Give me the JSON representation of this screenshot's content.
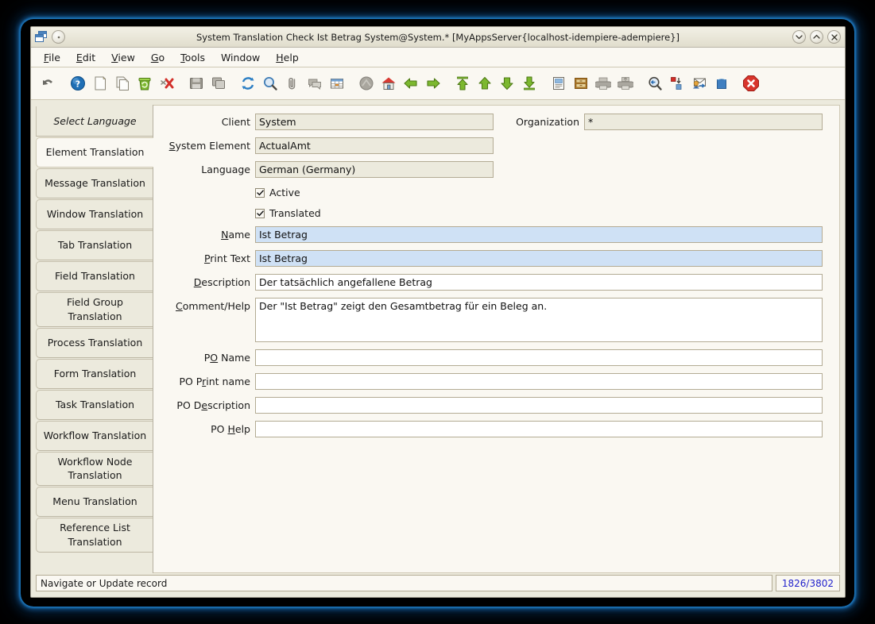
{
  "window": {
    "title": "System Translation Check  Ist Betrag  System@System.*  [MyAppsServer{localhost-idempiere-adempiere}]",
    "icon": "window-stack-icon",
    "minimize_label": "Minimize",
    "maximize_label": "Maximize",
    "close_label": "Close"
  },
  "menubar": {
    "items": [
      {
        "label": "File",
        "mnemonic": "F"
      },
      {
        "label": "Edit",
        "mnemonic": "E"
      },
      {
        "label": "View",
        "mnemonic": "V"
      },
      {
        "label": "Go",
        "mnemonic": "G"
      },
      {
        "label": "Tools",
        "mnemonic": "T"
      },
      {
        "label": "Window",
        "mnemonic": ""
      },
      {
        "label": "Help",
        "mnemonic": "H"
      }
    ]
  },
  "toolbar": {
    "buttons": [
      {
        "name": "undo-icon",
        "tip": "Undo"
      },
      {
        "name": "help-icon",
        "tip": "Help"
      },
      {
        "name": "new-record-icon",
        "tip": "New Record"
      },
      {
        "name": "copy-record-icon",
        "tip": "Copy Record"
      },
      {
        "name": "delete-record-icon",
        "tip": "Delete Record"
      },
      {
        "name": "delete-selection-icon",
        "tip": "Delete Selection"
      },
      {
        "name": "save-icon",
        "tip": "Save Changes"
      },
      {
        "name": "save-create-icon",
        "tip": "Save and Create New"
      },
      {
        "name": "refresh-icon",
        "tip": "Refresh"
      },
      {
        "name": "find-icon",
        "tip": "Find Records"
      },
      {
        "name": "attachment-icon",
        "tip": "Attachment"
      },
      {
        "name": "chat-icon",
        "tip": "Chat"
      },
      {
        "name": "grid-toggle-icon",
        "tip": "Toggle Grid View"
      },
      {
        "name": "history-icon",
        "tip": "History Records"
      },
      {
        "name": "home-icon",
        "tip": "Home"
      },
      {
        "name": "previous-record-icon",
        "tip": "Previous Record"
      },
      {
        "name": "next-record-icon",
        "tip": "Next Record"
      },
      {
        "name": "first-record-icon",
        "tip": "First Record"
      },
      {
        "name": "parent-record-icon",
        "tip": "Parent Record"
      },
      {
        "name": "detail-record-icon",
        "tip": "Detail Record"
      },
      {
        "name": "last-record-icon",
        "tip": "Last Record"
      },
      {
        "name": "report-icon",
        "tip": "Report"
      },
      {
        "name": "archive-icon",
        "tip": "Archived Documents"
      },
      {
        "name": "print-preview-icon",
        "tip": "Print Preview"
      },
      {
        "name": "print-icon",
        "tip": "Print"
      },
      {
        "name": "zoom-across-icon",
        "tip": "Zoom Across"
      },
      {
        "name": "active-workflow-icon",
        "tip": "Active Workflows"
      },
      {
        "name": "requests-icon",
        "tip": "Requests"
      },
      {
        "name": "product-info-icon",
        "tip": "Product Info"
      },
      {
        "name": "exit-icon",
        "tip": "Exit Window"
      }
    ]
  },
  "sidebar": {
    "tabs": [
      {
        "label": "Select Language",
        "style": "italic",
        "selected": false
      },
      {
        "label": "Element Translation",
        "style": "normal",
        "selected": true
      },
      {
        "label": "Message Translation",
        "style": "normal",
        "selected": false
      },
      {
        "label": "Window Translation",
        "style": "normal",
        "selected": false
      },
      {
        "label": "Tab Translation",
        "style": "normal",
        "selected": false
      },
      {
        "label": "Field Translation",
        "style": "normal",
        "selected": false
      },
      {
        "label": "Field Group Translation",
        "style": "normal",
        "selected": false
      },
      {
        "label": "Process Translation",
        "style": "normal",
        "selected": false
      },
      {
        "label": "Form Translation",
        "style": "normal",
        "selected": false
      },
      {
        "label": "Task Translation",
        "style": "normal",
        "selected": false
      },
      {
        "label": "Workflow Translation",
        "style": "normal",
        "selected": false
      },
      {
        "label": "Workflow Node Translation",
        "style": "normal",
        "selected": false
      },
      {
        "label": "Menu Translation",
        "style": "normal",
        "selected": false
      },
      {
        "label": "Reference List Translation",
        "style": "normal",
        "selected": false
      }
    ]
  },
  "form": {
    "client": {
      "label": "Client",
      "mnemonic": "",
      "value": "System"
    },
    "organization": {
      "label": "Organization",
      "mnemonic": "",
      "value": "*"
    },
    "system_element": {
      "label": "System Element",
      "mnemonic": "S",
      "value": "ActualAmt"
    },
    "language": {
      "label": "Language",
      "mnemonic": "",
      "value": "German (Germany)"
    },
    "active": {
      "label": "Active",
      "checked": true
    },
    "translated": {
      "label": "Translated",
      "checked": true
    },
    "name": {
      "label": "Name",
      "mnemonic": "N",
      "value": "Ist Betrag"
    },
    "print_text": {
      "label": "Print Text",
      "mnemonic": "P",
      "value": "Ist Betrag"
    },
    "description": {
      "label": "Description",
      "mnemonic": "D",
      "value": "Der tatsächlich angefallene Betrag"
    },
    "comment_help": {
      "label": "Comment/Help",
      "mnemonic": "C",
      "value": "Der \"Ist Betrag\" zeigt den Gesamtbetrag für ein Beleg an."
    },
    "po_name": {
      "label": "PO Name",
      "mnemonic": "O",
      "value": ""
    },
    "po_print_name": {
      "label": "PO Print name",
      "mnemonic": "r",
      "value": ""
    },
    "po_description": {
      "label": "PO Description",
      "mnemonic": "e",
      "value": ""
    },
    "po_help": {
      "label": "PO Help",
      "mnemonic": "H",
      "value": ""
    }
  },
  "statusbar": {
    "message": "Navigate or Update record",
    "record_count": "1826/3802"
  },
  "colors": {
    "window_bg": "#eceadd",
    "panel_bg": "#faf8f2",
    "field_readonly": "#eceadd",
    "field_mandatory": "#cfe1f5",
    "field_editable": "#ffffff",
    "record_count_text": "#2222cc",
    "border": "#b3ab94"
  }
}
